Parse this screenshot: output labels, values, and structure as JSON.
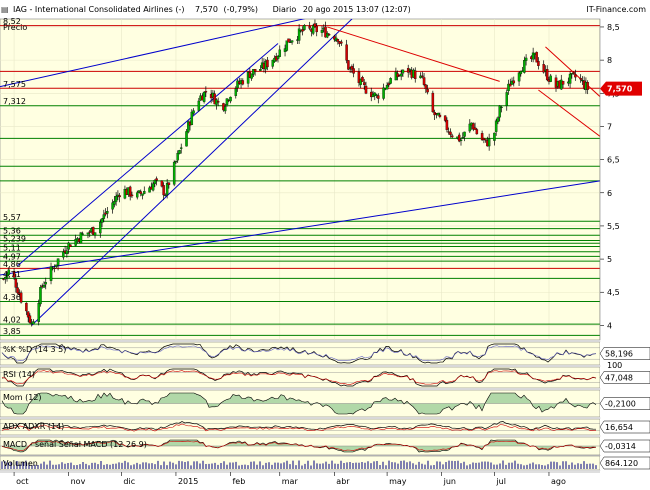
{
  "header": {
    "symbol": "IAG",
    "name": "International Consolidated Airlines",
    "extra": "(-)",
    "price": "7,570",
    "change": "(-0,79%)",
    "period": "Diario",
    "datetime": "20 ago 2015 13:07 (12:07)",
    "brand": "IT-Finance.com"
  },
  "colors": {
    "panel_bg": "#ffffe1",
    "grid": "#e8e8c8",
    "up": "#00b000",
    "down": "#d00000",
    "wick": "#000000",
    "horiz_green": "#008000",
    "horiz_red": "#cc0000",
    "trend_blue": "#0000cc",
    "channel_red": "#dd0000",
    "price_tag": "#e00000",
    "volume": "#000080"
  },
  "chart_data": {
    "type": "candlestick",
    "title": "IAG - International Consolidated Airlines (-) 7,570 (-0,79%) Diario 20 ago 2015 13:07 (12:07)",
    "ylabel": "Precio",
    "ylim": [
      3.78,
      8.62
    ],
    "y_ticks": [
      "8,5",
      "8",
      "7,5",
      "7",
      "6,5",
      "6",
      "5,5",
      "5",
      "4,5",
      "4"
    ],
    "x_months": [
      {
        "label": "oct",
        "day": 0
      },
      {
        "label": "nov",
        "day": 31
      },
      {
        "label": "dic",
        "day": 61
      },
      {
        "label": "2015",
        "day": 92
      },
      {
        "label": "feb",
        "day": 123
      },
      {
        "label": "mar",
        "day": 151
      },
      {
        "label": "abr",
        "day": 182
      },
      {
        "label": "may",
        "day": 212
      },
      {
        "label": "jun",
        "day": 243
      },
      {
        "label": "jul",
        "day": 273
      },
      {
        "label": "ago",
        "day": 304
      }
    ],
    "xlim_days": [
      -8,
      333
    ],
    "anchors": [
      [
        -6,
        4.7
      ],
      [
        -2,
        4.85
      ],
      [
        4,
        4.4
      ],
      [
        10,
        4.02
      ],
      [
        16,
        4.6
      ],
      [
        24,
        4.95
      ],
      [
        30,
        5.2
      ],
      [
        38,
        5.35
      ],
      [
        46,
        5.45
      ],
      [
        55,
        5.8
      ],
      [
        61,
        6.05
      ],
      [
        70,
        5.95
      ],
      [
        80,
        6.15
      ],
      [
        86,
        6.0
      ],
      [
        95,
        6.7
      ],
      [
        104,
        7.4
      ],
      [
        110,
        7.55
      ],
      [
        118,
        7.28
      ],
      [
        124,
        7.55
      ],
      [
        134,
        7.8
      ],
      [
        142,
        7.9
      ],
      [
        150,
        8.1
      ],
      [
        156,
        8.3
      ],
      [
        165,
        8.45
      ],
      [
        174,
        8.45
      ],
      [
        184,
        8.35
      ],
      [
        190,
        7.9
      ],
      [
        198,
        7.6
      ],
      [
        206,
        7.45
      ],
      [
        214,
        7.7
      ],
      [
        224,
        7.85
      ],
      [
        232,
        7.7
      ],
      [
        238,
        7.2
      ],
      [
        244,
        7.05
      ],
      [
        250,
        6.85
      ],
      [
        254,
        6.8
      ],
      [
        260,
        7.05
      ],
      [
        264,
        6.85
      ],
      [
        268,
        6.75
      ],
      [
        272,
        6.8
      ],
      [
        276,
        7.25
      ],
      [
        282,
        7.65
      ],
      [
        288,
        7.9
      ],
      [
        296,
        8.05
      ],
      [
        302,
        7.8
      ],
      [
        308,
        7.6
      ],
      [
        314,
        7.7
      ],
      [
        320,
        7.75
      ],
      [
        326,
        7.57
      ]
    ],
    "horizontal_levels": [
      {
        "value": 8.52,
        "label": "8,52",
        "color": "red"
      },
      {
        "value": 7.575,
        "label": "7,575",
        "color": "red"
      },
      {
        "value": 7.312,
        "label": "7,312",
        "color": "green"
      },
      {
        "value": 5.57,
        "label": "5,57",
        "color": "green"
      },
      {
        "value": 5.36,
        "label": "5,36",
        "color": "green"
      },
      {
        "value": 5.239,
        "label": "5,239",
        "color": "green"
      },
      {
        "value": 5.11,
        "label": "5,11",
        "color": "green"
      },
      {
        "value": 4.97,
        "label": "4,97",
        "color": "green"
      },
      {
        "value": 4.86,
        "label": "4,86",
        "color": "red"
      },
      {
        "value": 4.71,
        "label": "4,71",
        "color": "green"
      },
      {
        "value": 4.36,
        "label": "4,36",
        "color": "green"
      },
      {
        "value": 4.02,
        "label": "4,02",
        "color": "green"
      },
      {
        "value": 3.85,
        "label": "3,85",
        "color": "green"
      },
      {
        "value": 7.83,
        "label": "",
        "color": "red"
      },
      {
        "value": 6.82,
        "label": "",
        "color": "green"
      },
      {
        "value": 6.4,
        "label": "",
        "color": "green"
      },
      {
        "value": 6.18,
        "label": "",
        "color": "green"
      },
      {
        "value": 5.46,
        "label": "",
        "color": "green"
      },
      {
        "value": 5.28,
        "label": "",
        "color": "green"
      },
      {
        "value": 5.19,
        "label": "",
        "color": "green"
      },
      {
        "value": 5.04,
        "label": "",
        "color": "green"
      }
    ],
    "trend_lines": [
      {
        "color": "blue",
        "points": [
          [
            -8,
            7.6
          ],
          [
            220,
            8.95
          ]
        ]
      },
      {
        "color": "blue",
        "points": [
          [
            -8,
            4.76
          ],
          [
            333,
            6.18
          ]
        ]
      },
      {
        "color": "blue",
        "points": [
          [
            2,
            4.9
          ],
          [
            150,
            8.25
          ]
        ]
      },
      {
        "color": "blue",
        "points": [
          [
            10,
            4.0
          ],
          [
            205,
            8.95
          ]
        ]
      },
      {
        "color": "red",
        "points": [
          [
            178,
            8.5
          ],
          [
            276,
            7.68
          ]
        ]
      },
      {
        "color": "red",
        "points": [
          [
            302,
            8.2
          ],
          [
            333,
            7.45
          ]
        ]
      },
      {
        "color": "red",
        "points": [
          [
            298,
            7.55
          ],
          [
            333,
            6.85
          ]
        ]
      }
    ],
    "last_price": {
      "value": 7.57,
      "label": "7,570"
    },
    "indicators": [
      {
        "name": "%K",
        "title": "%K",
        "params": "%D (14 3 5)",
        "value": "58,196",
        "top_label": ""
      },
      {
        "name": "RSI",
        "title": "RSI (14)",
        "params": "",
        "value": "47,048",
        "top_label": "100"
      },
      {
        "name": "MOM",
        "title": "Mom (12)",
        "params": "",
        "value": "-0,2100",
        "top_label": ""
      },
      {
        "name": "ADX",
        "title": "ADX",
        "params": "ADXR (14)",
        "value": "16,654",
        "top_label": ""
      },
      {
        "name": "MACD",
        "title": "MACD -",
        "params": "señal  Señal  MACD (12 26 9)",
        "value": "-0,0314",
        "top_label": ""
      },
      {
        "name": "VOL",
        "title": "Volumen",
        "params": "",
        "value": "864.120",
        "top_label": ""
      }
    ]
  }
}
